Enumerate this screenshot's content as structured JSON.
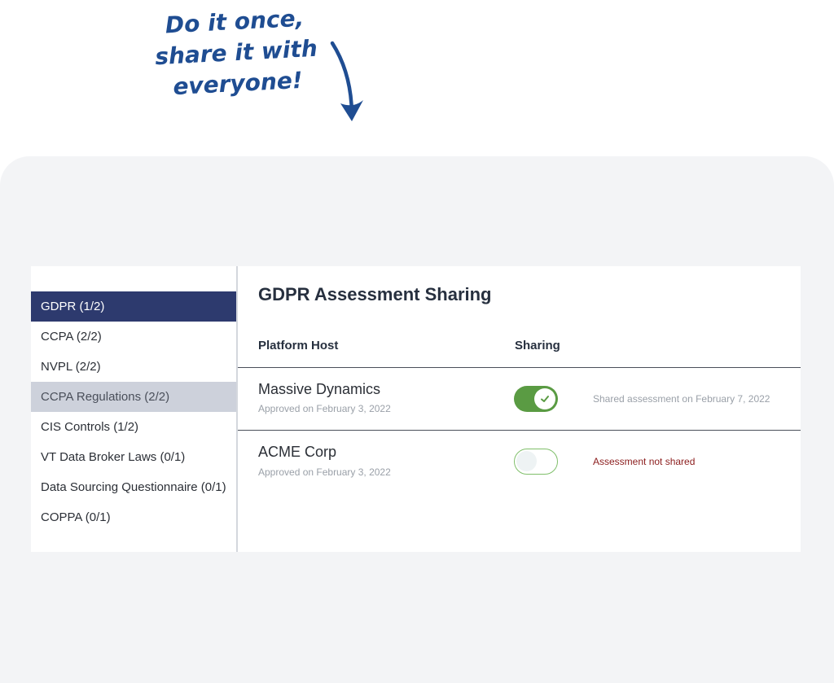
{
  "callout": {
    "lines": [
      "Do it once,",
      "share it with",
      "everyone!"
    ],
    "color": "#1f4d92"
  },
  "sidebar": {
    "items": [
      {
        "label": "GDPR (1/2)",
        "state": "active"
      },
      {
        "label": "CCPA (2/2)",
        "state": "normal"
      },
      {
        "label": "NVPL (2/2)",
        "state": "normal"
      },
      {
        "label": "CCPA Regulations (2/2)",
        "state": "hover"
      },
      {
        "label": "CIS Controls (1/2)",
        "state": "normal"
      },
      {
        "label": "VT Data Broker Laws (0/1)",
        "state": "normal"
      },
      {
        "label": "Data Sourcing Questionnaire (0/1)",
        "state": "normal"
      },
      {
        "label": "COPPA (0/1)",
        "state": "normal"
      }
    ]
  },
  "main": {
    "title": "GDPR Assessment Sharing",
    "columns": {
      "host": "Platform Host",
      "sharing": "Sharing"
    },
    "rows": [
      {
        "name": "Massive Dynamics",
        "approved": "Approved on February 3, 2022",
        "sharing_on": true,
        "status": "Shared assessment on February 7, 2022",
        "status_color": "#9aa0a8"
      },
      {
        "name": "ACME Corp",
        "approved": "Approved on February 3, 2022",
        "sharing_on": false,
        "status": "Assessment not shared",
        "status_color": "#8b1c1c"
      }
    ]
  },
  "colors": {
    "active_nav": "#2d3a6e",
    "hover_nav": "#cdd1db",
    "toggle_on": "#5a9b43",
    "panel_bg": "#f3f4f6"
  }
}
